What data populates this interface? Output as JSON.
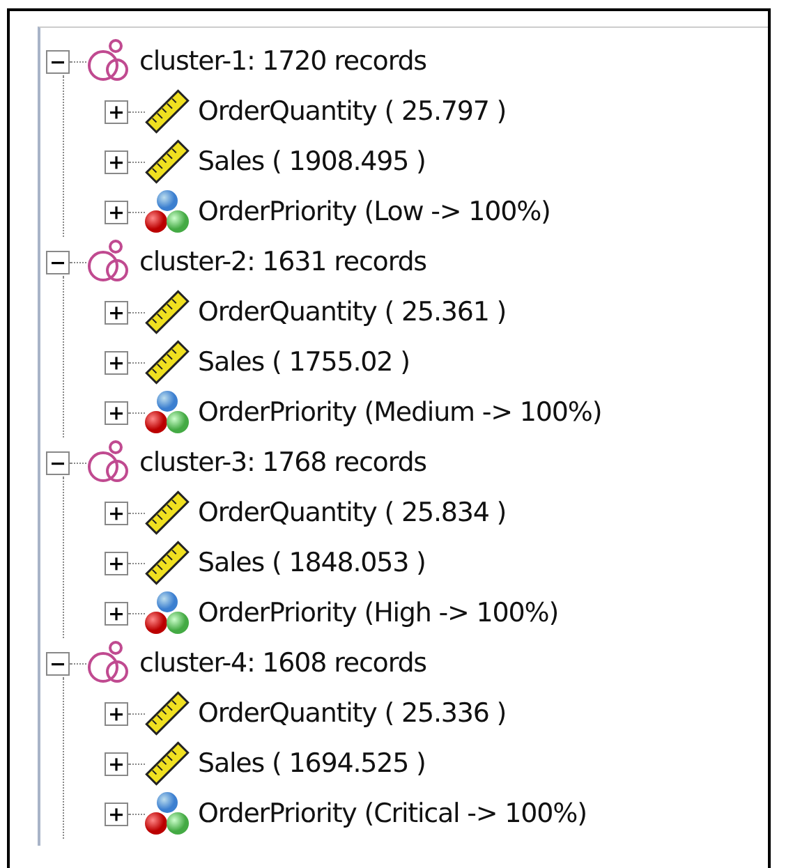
{
  "tree": [
    {
      "label": "cluster-1: 1720 records",
      "expanded": true,
      "children": [
        {
          "kind": "numeric",
          "label": "OrderQuantity ( 25.797 )",
          "expanded": false
        },
        {
          "kind": "numeric",
          "label": "Sales ( 1908.495 )",
          "expanded": false
        },
        {
          "kind": "nominal",
          "label": "OrderPriority (Low -> 100%)",
          "expanded": false
        }
      ]
    },
    {
      "label": "cluster-2: 1631 records",
      "expanded": true,
      "children": [
        {
          "kind": "numeric",
          "label": "OrderQuantity ( 25.361 )",
          "expanded": false
        },
        {
          "kind": "numeric",
          "label": "Sales ( 1755.02 )",
          "expanded": false
        },
        {
          "kind": "nominal",
          "label": "OrderPriority (Medium -> 100%)",
          "expanded": false
        }
      ]
    },
    {
      "label": "cluster-3: 1768 records",
      "expanded": true,
      "children": [
        {
          "kind": "numeric",
          "label": "OrderQuantity ( 25.834 )",
          "expanded": false
        },
        {
          "kind": "numeric",
          "label": "Sales ( 1848.053 )",
          "expanded": false
        },
        {
          "kind": "nominal",
          "label": "OrderPriority (High -> 100%)",
          "expanded": false
        }
      ]
    },
    {
      "label": "cluster-4: 1608 records",
      "expanded": true,
      "children": [
        {
          "kind": "numeric",
          "label": "OrderQuantity ( 25.336 )",
          "expanded": false
        },
        {
          "kind": "numeric",
          "label": "Sales ( 1694.525 )",
          "expanded": false
        },
        {
          "kind": "nominal",
          "label": "OrderPriority (Critical -> 100%)",
          "expanded": false
        }
      ]
    }
  ]
}
